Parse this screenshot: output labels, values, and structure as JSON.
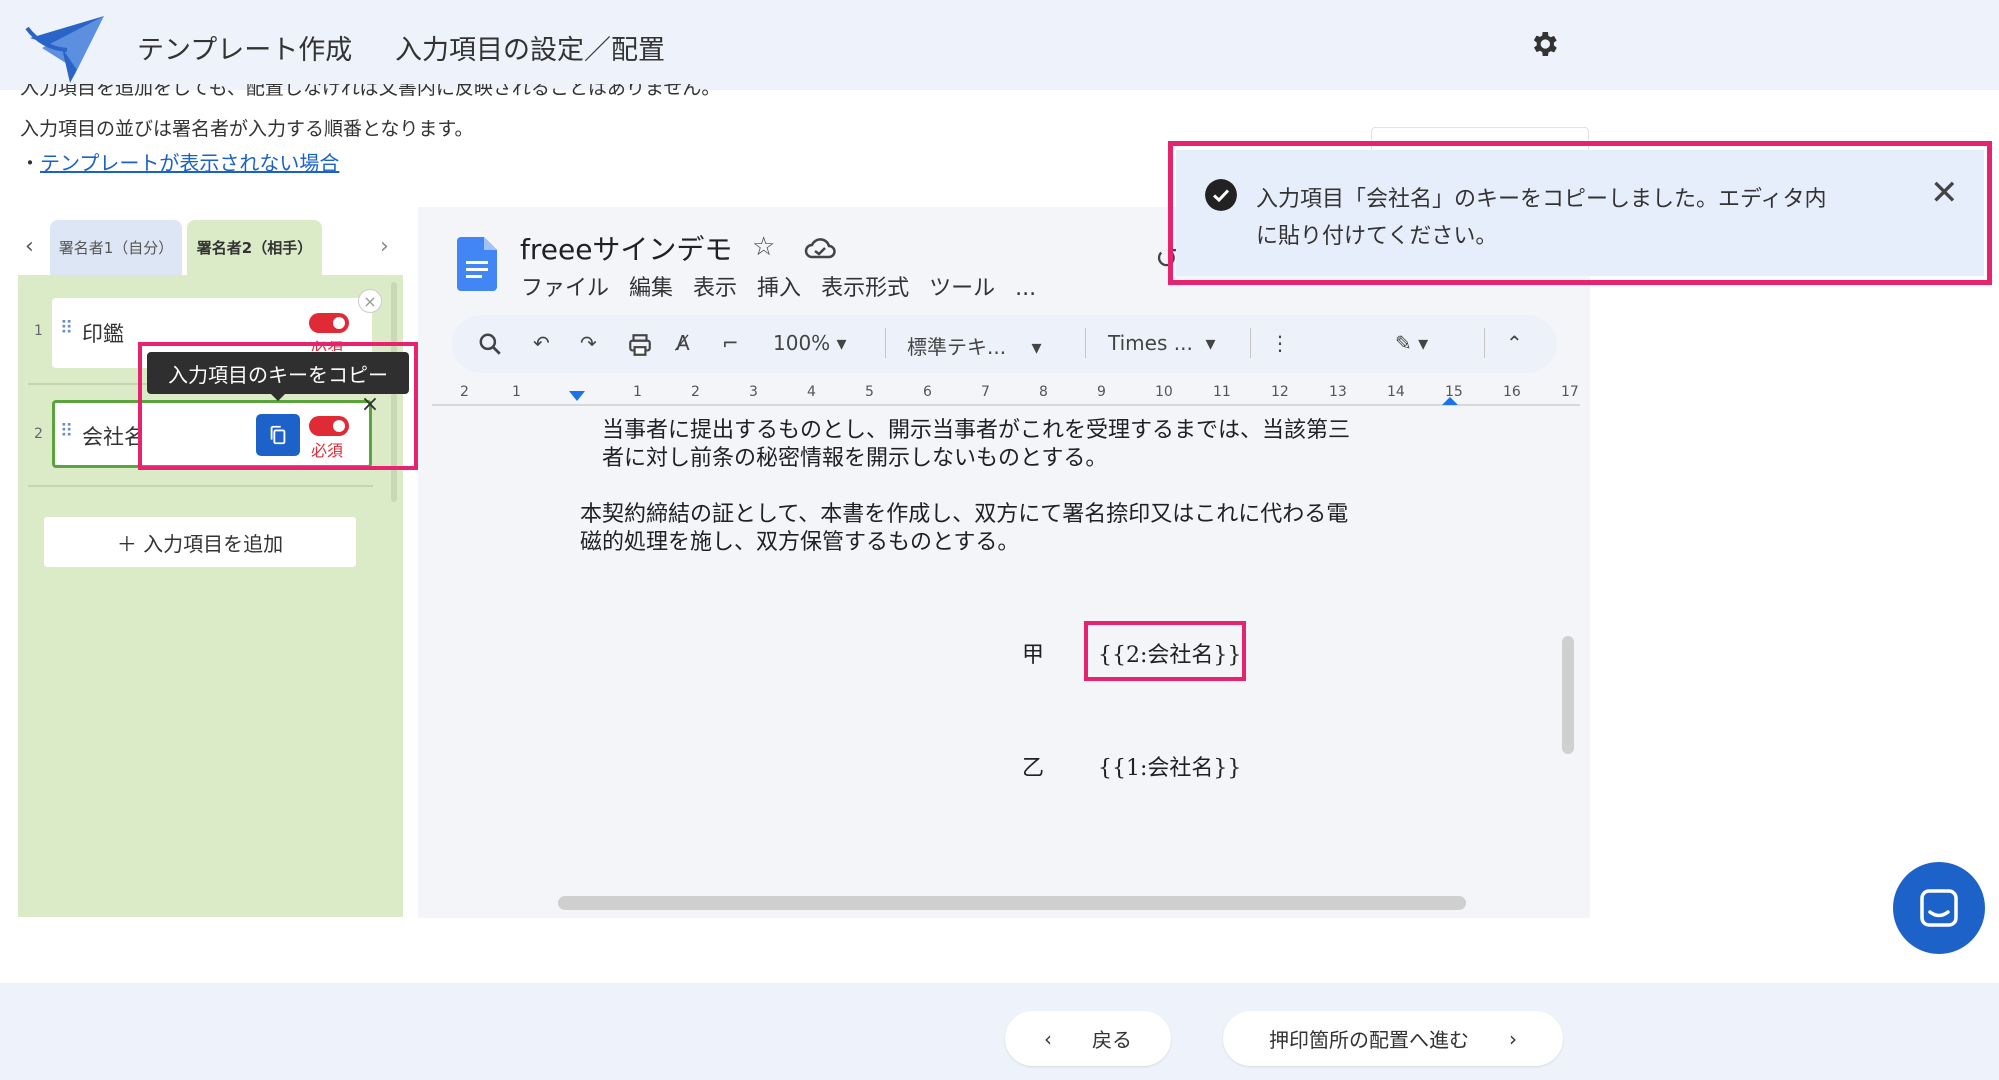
{
  "header": {
    "app_title": "テンプレート作成",
    "page_subtitle": "入力項目の設定／配置",
    "settings_icon": "gear-icon"
  },
  "intro": {
    "line_cut": "入力項目を追加をしても、配置しなければ文書内に反映されることはありません。",
    "line1": "入力項目の並びは署名者が入力する順番となります。",
    "bullet": "・",
    "help_link": "テンプレートが表示されない場合"
  },
  "signer_tabs": [
    {
      "label": "署名者1（自分）"
    },
    {
      "label": "署名者2（相手）"
    }
  ],
  "fields": [
    {
      "num": "1",
      "label": "印鑑",
      "required_label": "必須"
    },
    {
      "num": "2",
      "label": "会社名",
      "required_label": "必須"
    }
  ],
  "tooltip": "入力項目のキーをコピー",
  "add_field_button": "＋  入力項目を追加",
  "docs": {
    "title": "freeeサインデモ",
    "menu": [
      "ファイル",
      "編集",
      "表示",
      "挿入",
      "表示形式",
      "ツール",
      "..."
    ],
    "zoom": "100%",
    "style_select": "標準テキ...",
    "font_select": "Times ...",
    "ruler_numbers": [
      "2",
      "1",
      "1",
      "2",
      "3",
      "4",
      "5",
      "6",
      "7",
      "8",
      "9",
      "10",
      "11",
      "12",
      "13",
      "14",
      "15",
      "16",
      "17"
    ],
    "paragraph1_line1": "当事者に提出するものとし、開示当事者がこれを受理するまでは、当該第三",
    "paragraph1_line2": "者に対し前条の秘密情報を開示しないものとする。",
    "paragraph2_line1": "本契約締結の証として、本書を作成し、双方にて署名捺印又はこれに代わる電",
    "paragraph2_line2": "磁的処理を施し、双方保管するものとする。",
    "party_a_label": "甲",
    "party_a_value": "{{2:会社名}}",
    "party_b_label": "乙",
    "party_b_value": "{{1:会社名}}"
  },
  "toast": {
    "line1": "入力項目「会社名」のキーをコピーしました。エディタ内",
    "line2": "に貼り付けてください。"
  },
  "footer": {
    "back": "戻る",
    "next": "押印箇所の配置へ進む"
  },
  "colors": {
    "accent_blue": "#1d62c9",
    "highlight_pink": "#e6236f",
    "required_red": "#e02a36",
    "panel_green": "#dcebc7",
    "header_bg": "#eef3fb"
  }
}
